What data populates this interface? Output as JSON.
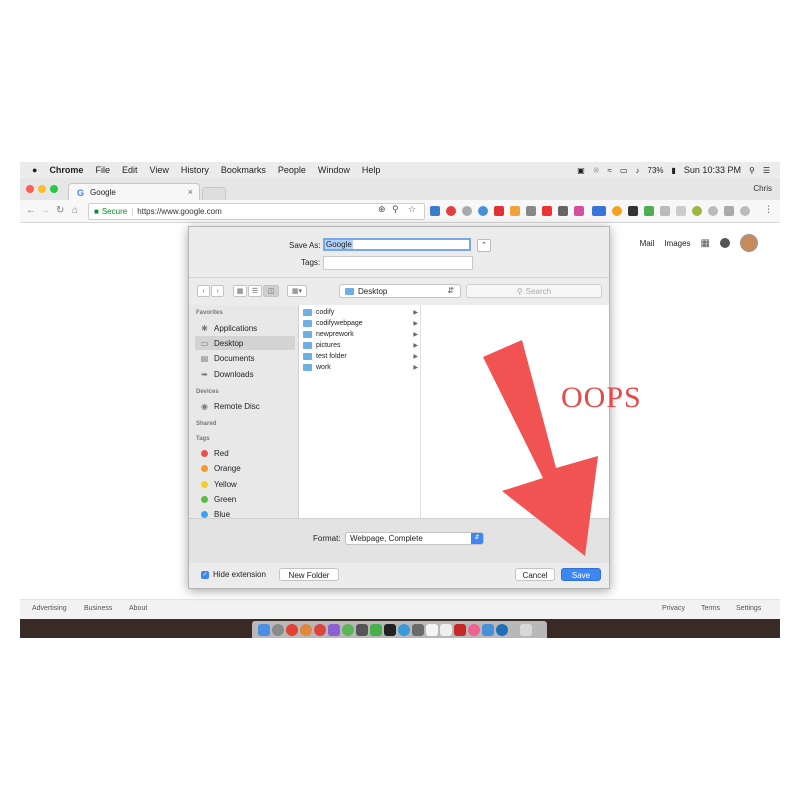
{
  "menubar": {
    "app": "Chrome",
    "items": [
      "File",
      "Edit",
      "View",
      "History",
      "Bookmarks",
      "People",
      "Window",
      "Help"
    ],
    "battery": "73%",
    "clock": "Sun 10:33 PM"
  },
  "browser": {
    "tab_title": "Google",
    "tab_favicon": "G",
    "profile": "Chris",
    "secure_label": "Secure",
    "url": "https://www.google.com"
  },
  "google": {
    "mail": "Mail",
    "images": "Images",
    "footer_left": [
      "Advertising",
      "Business",
      "About"
    ],
    "footer_right": [
      "Privacy",
      "Terms",
      "Settings"
    ]
  },
  "dialog": {
    "save_as_label": "Save As:",
    "save_as_value": "Google",
    "tags_label": "Tags:",
    "location": "Desktop",
    "search_placeholder": "Search",
    "sidebar": {
      "favorites_header": "Favorites",
      "favorites": [
        "Applications",
        "Desktop",
        "Documents",
        "Downloads"
      ],
      "devices_header": "Devices",
      "devices": [
        "Remote Disc"
      ],
      "shared_header": "Shared",
      "tags_header": "Tags",
      "tags": [
        {
          "name": "Red",
          "color": "#f0504a"
        },
        {
          "name": "Orange",
          "color": "#f59a2e"
        },
        {
          "name": "Yellow",
          "color": "#f3cc2d"
        },
        {
          "name": "Green",
          "color": "#56c040"
        },
        {
          "name": "Blue",
          "color": "#3ea2f0"
        }
      ]
    },
    "folders": [
      "codify",
      "codifywebpage",
      "newprework",
      "pictures",
      "test folder",
      "work"
    ],
    "format_label": "Format:",
    "format_value": "Webpage, Complete",
    "hide_extension": "Hide extension",
    "new_folder": "New Folder",
    "cancel": "Cancel",
    "save": "Save"
  },
  "annotation": {
    "text": "OOPS",
    "color": "#f15353"
  }
}
